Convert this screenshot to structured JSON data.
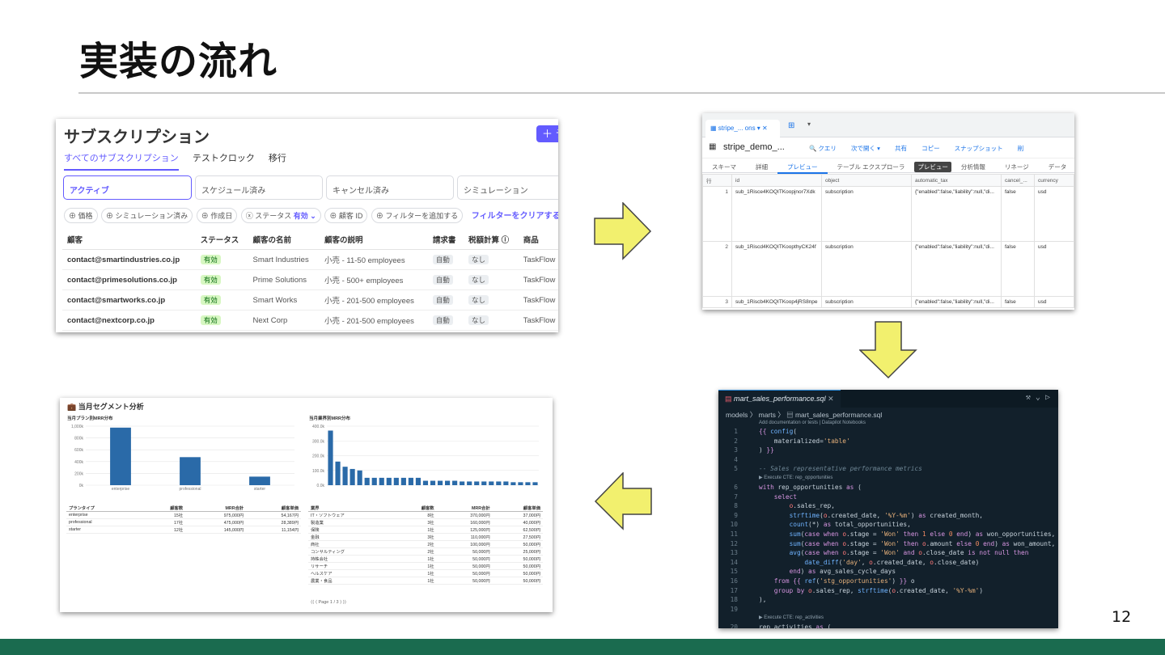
{
  "slide": {
    "title": "実装の流れ",
    "page_number": "12",
    "footer_color": "#1a6b4f"
  },
  "stripe": {
    "heading": "サブスクリプション",
    "new_button": "＋ テ",
    "tabs": [
      "すべてのサブスクリプション",
      "テストクロック",
      "移行"
    ],
    "filter_boxes": [
      "アクティブ",
      "スケジュール済み",
      "キャンセル済み",
      "シミュレーション"
    ],
    "chips": [
      "⊕ 価格",
      "⊕ シミュレーション済み",
      "⊕ 作成日",
      "ⓧ ステータス",
      "⊕ 顧客 ID",
      "⊕ フィルターを追加する"
    ],
    "status_value": "有効 ⌄",
    "clear_filters": "フィルターをクリアする",
    "columns": [
      "顧客",
      "ステータス",
      "顧客の名前",
      "顧客の説明",
      "請求書",
      "税額計算 ⓘ",
      "商品"
    ],
    "rows": [
      {
        "email": "contact@smartindustries.co.jp",
        "status": "有効",
        "name": "Smart Industries",
        "desc": "小売 - 11-50 employees",
        "invoice": "自動",
        "tax": "なし",
        "product": "TaskFlow"
      },
      {
        "email": "contact@primesolutions.co.jp",
        "status": "有効",
        "name": "Prime Solutions",
        "desc": "小売 - 500+ employees",
        "invoice": "自動",
        "tax": "なし",
        "product": "TaskFlow"
      },
      {
        "email": "contact@smartworks.co.jp",
        "status": "有効",
        "name": "Smart Works",
        "desc": "小売 - 201-500 employees",
        "invoice": "自動",
        "tax": "なし",
        "product": "TaskFlow"
      },
      {
        "email": "contact@nextcorp.co.jp",
        "status": "有効",
        "name": "Next Corp",
        "desc": "小売 - 201-500 employees",
        "invoice": "自動",
        "tax": "なし",
        "product": "TaskFlow"
      }
    ]
  },
  "bigquery": {
    "tab_label": "stripe_... ons ▾  ✕",
    "table_name": "stripe_demo_...",
    "actions": [
      "🔍 クエリ",
      "次で開く ▾",
      "共有",
      "コピー",
      "スナップショット",
      "削"
    ],
    "subtabs": [
      "スキーマ",
      "詳細",
      "プレビュー",
      "テーブル エクスプローラ",
      "プレビュー",
      "分析情報",
      "リネージ",
      "データ"
    ],
    "columns": [
      "行",
      "id",
      "object",
      "automatic_tax",
      "cancel_...",
      "currency"
    ],
    "rows": [
      {
        "n": "1",
        "id": "sub_1Risce4KOQITKoopjnor7Xdk",
        "object": "subscription",
        "tax": "{\"enabled\":false,\"liability\":null,\"di...",
        "cancel": "false",
        "currency": "usd"
      },
      {
        "n": "2",
        "id": "sub_1Riscd4KOQITKoopthyCK24f",
        "object": "subscription",
        "tax": "{\"enabled\":false,\"liability\":null,\"di...",
        "cancel": "false",
        "currency": "usd"
      },
      {
        "n": "3",
        "id": "sub_1Riscb4KOQITKoop4jRS8npe",
        "object": "subscription",
        "tax": "{\"enabled\":false,\"liability\":null,\"di...",
        "cancel": "false",
        "currency": "usd"
      }
    ]
  },
  "editor": {
    "tab": "mart_sales_performance.sql",
    "breadcrumb": "models 〉 marts 〉 ▤ mart_sales_performance.sql",
    "hint": "Add documentation or tests | Datapilot Notebooks",
    "codelens_1": "▶ Execute CTE: rep_opportunities",
    "codelens_2": "▶ Execute CTE: rep_activities"
  },
  "dashboard": {
    "title": "💼 当月セグメント分析",
    "plan_chart_title": "当月プラン別MRR分布",
    "industry_chart_title": "当月業界別MRR分布",
    "plan_table": {
      "headers": [
        "プランタイプ",
        "顧客数",
        "MRR合計",
        "顧客単価"
      ],
      "rows": [
        [
          "enterprise",
          "15社",
          "975,000円",
          "54,167円"
        ],
        [
          "professional",
          "17社",
          "475,000円",
          "28,389円"
        ],
        [
          "starter",
          "12社",
          "145,000円",
          "11,154円"
        ]
      ]
    },
    "industry_table": {
      "headers": [
        "業界",
        "顧客数",
        "MRR合計",
        "顧客単価"
      ],
      "rows": [
        [
          "IT・ソフトウェア",
          "8社",
          "370,000円",
          "37,000円"
        ],
        [
          "製造業",
          "3社",
          "160,000円",
          "40,000円"
        ],
        [
          "保険",
          "1社",
          "125,000円",
          "62,500円"
        ],
        [
          "金融",
          "3社",
          "110,000円",
          "27,500円"
        ],
        [
          "商社",
          "2社",
          "100,000円",
          "50,000円"
        ],
        [
          "コンサルティング",
          "2社",
          "50,000円",
          "25,000円"
        ],
        [
          "持株会社",
          "1社",
          "50,000円",
          "50,000円"
        ],
        [
          "リサーチ",
          "1社",
          "50,000円",
          "50,000円"
        ],
        [
          "ヘルスケア",
          "1社",
          "50,000円",
          "50,000円"
        ],
        [
          "農業・食品",
          "1社",
          "50,000円",
          "50,000円"
        ]
      ]
    },
    "pager": "⟨⟨  ⟨  Page  1  / 3  ⟩  ⟩⟩"
  },
  "chart_data": [
    {
      "type": "bar",
      "title": "当月プラン別MRR分布",
      "categories": [
        "enterprise",
        "professional",
        "starter"
      ],
      "values": [
        975000,
        475000,
        145000
      ],
      "ylim": [
        0,
        1000000
      ],
      "yticks": [
        "1,000k",
        "800k",
        "600k",
        "400k",
        "200k",
        "0k"
      ],
      "color": "#2a6aa8"
    },
    {
      "type": "bar",
      "title": "当月業界別MRR分布",
      "values": [
        370000,
        160000,
        125000,
        110000,
        100000,
        50000,
        50000,
        50000,
        50000,
        50000,
        50000,
        50000,
        50000,
        30000,
        30000,
        30000,
        30000,
        30000,
        25000,
        25000,
        25000,
        25000,
        25000,
        25000,
        25000,
        20000,
        20000,
        20000,
        20000
      ],
      "ylim": [
        0,
        400000
      ],
      "yticks": [
        "400.0k",
        "300.0k",
        "200.0k",
        "100.0k",
        "0.0k"
      ],
      "color": "#2a6aa8"
    }
  ]
}
